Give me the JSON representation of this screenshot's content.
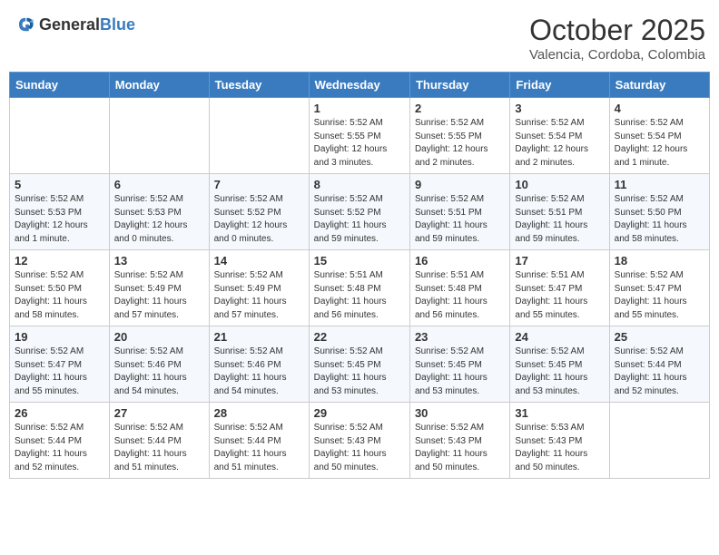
{
  "logo": {
    "general": "General",
    "blue": "Blue"
  },
  "header": {
    "month": "October 2025",
    "location": "Valencia, Cordoba, Colombia"
  },
  "weekdays": [
    "Sunday",
    "Monday",
    "Tuesday",
    "Wednesday",
    "Thursday",
    "Friday",
    "Saturday"
  ],
  "weeks": [
    [
      {
        "day": "",
        "info": ""
      },
      {
        "day": "",
        "info": ""
      },
      {
        "day": "",
        "info": ""
      },
      {
        "day": "1",
        "info": "Sunrise: 5:52 AM\nSunset: 5:55 PM\nDaylight: 12 hours\nand 3 minutes."
      },
      {
        "day": "2",
        "info": "Sunrise: 5:52 AM\nSunset: 5:55 PM\nDaylight: 12 hours\nand 2 minutes."
      },
      {
        "day": "3",
        "info": "Sunrise: 5:52 AM\nSunset: 5:54 PM\nDaylight: 12 hours\nand 2 minutes."
      },
      {
        "day": "4",
        "info": "Sunrise: 5:52 AM\nSunset: 5:54 PM\nDaylight: 12 hours\nand 1 minute."
      }
    ],
    [
      {
        "day": "5",
        "info": "Sunrise: 5:52 AM\nSunset: 5:53 PM\nDaylight: 12 hours\nand 1 minute."
      },
      {
        "day": "6",
        "info": "Sunrise: 5:52 AM\nSunset: 5:53 PM\nDaylight: 12 hours\nand 0 minutes."
      },
      {
        "day": "7",
        "info": "Sunrise: 5:52 AM\nSunset: 5:52 PM\nDaylight: 12 hours\nand 0 minutes."
      },
      {
        "day": "8",
        "info": "Sunrise: 5:52 AM\nSunset: 5:52 PM\nDaylight: 11 hours\nand 59 minutes."
      },
      {
        "day": "9",
        "info": "Sunrise: 5:52 AM\nSunset: 5:51 PM\nDaylight: 11 hours\nand 59 minutes."
      },
      {
        "day": "10",
        "info": "Sunrise: 5:52 AM\nSunset: 5:51 PM\nDaylight: 11 hours\nand 59 minutes."
      },
      {
        "day": "11",
        "info": "Sunrise: 5:52 AM\nSunset: 5:50 PM\nDaylight: 11 hours\nand 58 minutes."
      }
    ],
    [
      {
        "day": "12",
        "info": "Sunrise: 5:52 AM\nSunset: 5:50 PM\nDaylight: 11 hours\nand 58 minutes."
      },
      {
        "day": "13",
        "info": "Sunrise: 5:52 AM\nSunset: 5:49 PM\nDaylight: 11 hours\nand 57 minutes."
      },
      {
        "day": "14",
        "info": "Sunrise: 5:52 AM\nSunset: 5:49 PM\nDaylight: 11 hours\nand 57 minutes."
      },
      {
        "day": "15",
        "info": "Sunrise: 5:51 AM\nSunset: 5:48 PM\nDaylight: 11 hours\nand 56 minutes."
      },
      {
        "day": "16",
        "info": "Sunrise: 5:51 AM\nSunset: 5:48 PM\nDaylight: 11 hours\nand 56 minutes."
      },
      {
        "day": "17",
        "info": "Sunrise: 5:51 AM\nSunset: 5:47 PM\nDaylight: 11 hours\nand 55 minutes."
      },
      {
        "day": "18",
        "info": "Sunrise: 5:52 AM\nSunset: 5:47 PM\nDaylight: 11 hours\nand 55 minutes."
      }
    ],
    [
      {
        "day": "19",
        "info": "Sunrise: 5:52 AM\nSunset: 5:47 PM\nDaylight: 11 hours\nand 55 minutes."
      },
      {
        "day": "20",
        "info": "Sunrise: 5:52 AM\nSunset: 5:46 PM\nDaylight: 11 hours\nand 54 minutes."
      },
      {
        "day": "21",
        "info": "Sunrise: 5:52 AM\nSunset: 5:46 PM\nDaylight: 11 hours\nand 54 minutes."
      },
      {
        "day": "22",
        "info": "Sunrise: 5:52 AM\nSunset: 5:45 PM\nDaylight: 11 hours\nand 53 minutes."
      },
      {
        "day": "23",
        "info": "Sunrise: 5:52 AM\nSunset: 5:45 PM\nDaylight: 11 hours\nand 53 minutes."
      },
      {
        "day": "24",
        "info": "Sunrise: 5:52 AM\nSunset: 5:45 PM\nDaylight: 11 hours\nand 53 minutes."
      },
      {
        "day": "25",
        "info": "Sunrise: 5:52 AM\nSunset: 5:44 PM\nDaylight: 11 hours\nand 52 minutes."
      }
    ],
    [
      {
        "day": "26",
        "info": "Sunrise: 5:52 AM\nSunset: 5:44 PM\nDaylight: 11 hours\nand 52 minutes."
      },
      {
        "day": "27",
        "info": "Sunrise: 5:52 AM\nSunset: 5:44 PM\nDaylight: 11 hours\nand 51 minutes."
      },
      {
        "day": "28",
        "info": "Sunrise: 5:52 AM\nSunset: 5:44 PM\nDaylight: 11 hours\nand 51 minutes."
      },
      {
        "day": "29",
        "info": "Sunrise: 5:52 AM\nSunset: 5:43 PM\nDaylight: 11 hours\nand 50 minutes."
      },
      {
        "day": "30",
        "info": "Sunrise: 5:52 AM\nSunset: 5:43 PM\nDaylight: 11 hours\nand 50 minutes."
      },
      {
        "day": "31",
        "info": "Sunrise: 5:53 AM\nSunset: 5:43 PM\nDaylight: 11 hours\nand 50 minutes."
      },
      {
        "day": "",
        "info": ""
      }
    ]
  ]
}
